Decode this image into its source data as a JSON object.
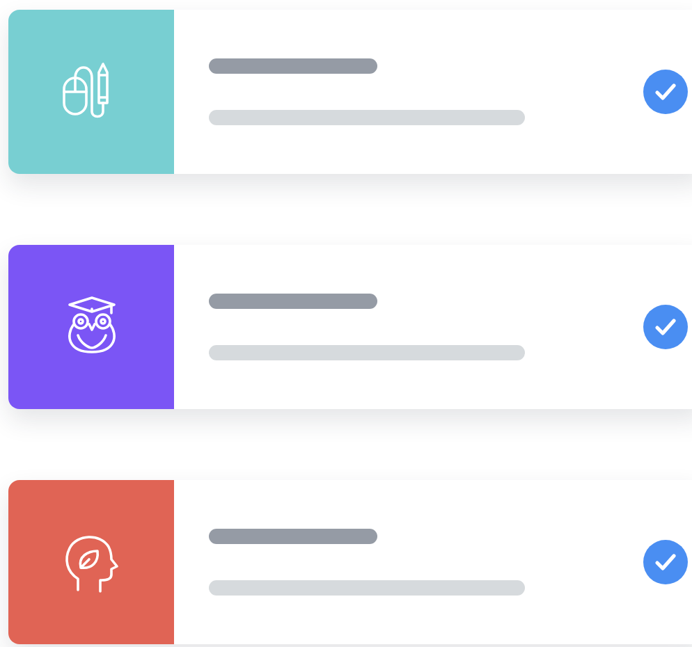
{
  "cards": [
    {
      "kind": "mouse-pen",
      "color": "#78cfd2",
      "checked": true
    },
    {
      "kind": "owl",
      "color": "#7b55f5",
      "checked": true
    },
    {
      "kind": "head-leaf",
      "color": "#e06455",
      "checked": true
    }
  ]
}
